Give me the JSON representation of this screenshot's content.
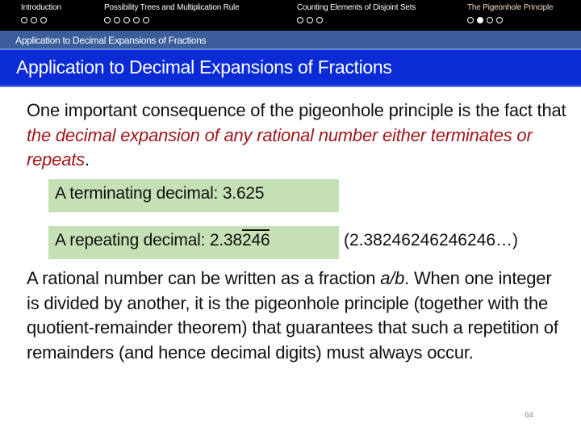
{
  "nav": {
    "sections": [
      {
        "label": "Introduction",
        "dots": 3,
        "active_dot": null,
        "current": false
      },
      {
        "label": "Possibility Trees and Multiplication Rule",
        "dots": 5,
        "active_dot": null,
        "current": false
      },
      {
        "label": "Counting Elements of Disjoint Sets",
        "dots": 3,
        "active_dot": null,
        "current": false
      },
      {
        "label": "The Pigeonhole Principle",
        "dots": 4,
        "active_dot": 2,
        "current": true
      }
    ]
  },
  "subsection": "Application to Decimal Expansions of Fractions",
  "title": "Application to Decimal Expansions of Fractions",
  "para1": {
    "plain": "One important consequence of the pigeonhole principle is the fact that ",
    "emph": "the decimal expansion of any rational number either terminates or repeats",
    "end": "."
  },
  "box1": "A terminating decimal: 3.625",
  "box2": {
    "prefix": "A repeating decimal: 2.38",
    "overline": "246"
  },
  "repeat_expansion": "(2.38246246246246…)",
  "para2": {
    "a": "A rational number can be written as a fraction ",
    "frac": "a/b",
    "b": ". When one integer is divided by another, it is the pigeonhole principle (together with the quotient-remainder theorem) that guarantees that such a repetition of remainders (and hence decimal digits) must always occur."
  },
  "page_number": "64",
  "colors": {
    "nav_bg": "#000000",
    "subsection_bg": "#3a5d9c",
    "title_bg": "#0a2bd6",
    "emphasis": "#a0171a",
    "box_bg": "#c5e0b4"
  }
}
